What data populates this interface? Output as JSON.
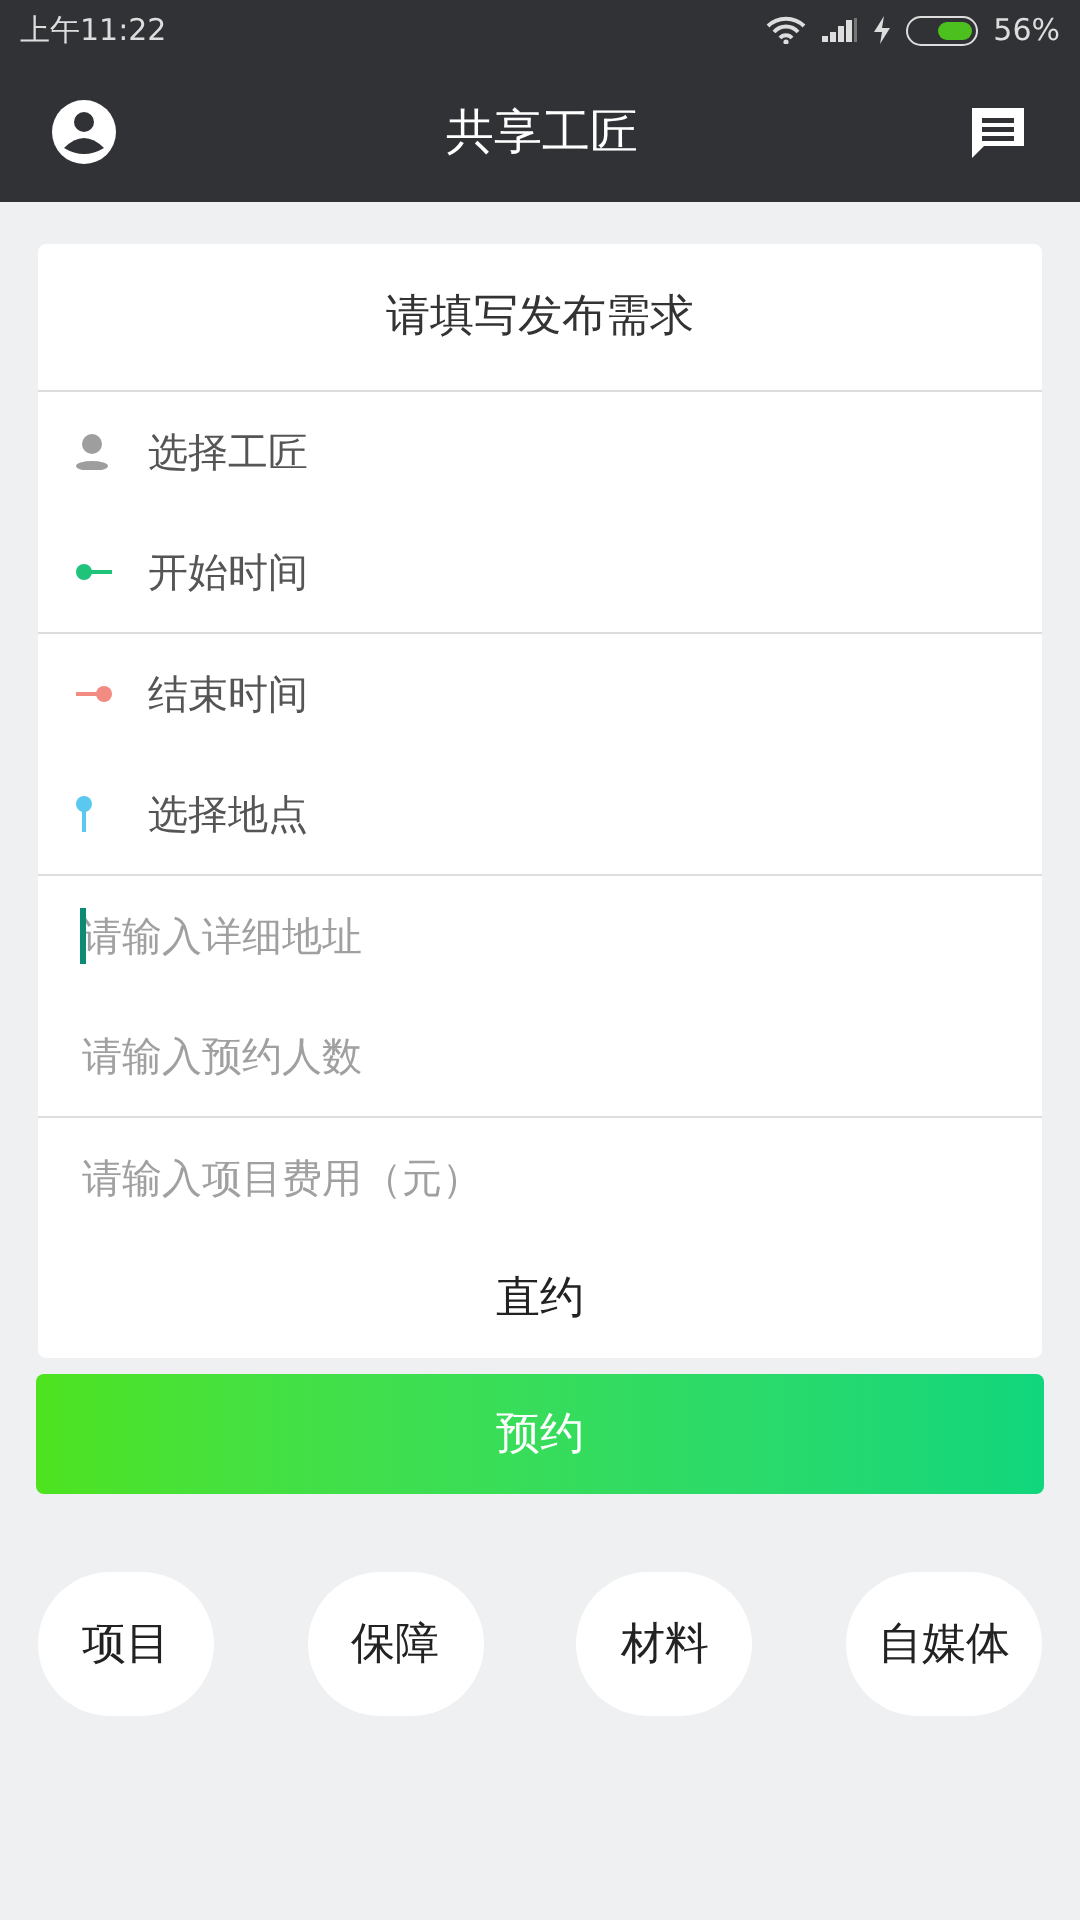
{
  "status_bar": {
    "time": "上午11:22",
    "battery": "56%"
  },
  "app_bar": {
    "title": "共享工匠"
  },
  "form": {
    "title": "请填写发布需求",
    "groups": [
      {
        "kind": "pickers",
        "items": [
          {
            "label": "选择工匠"
          },
          {
            "label": "开始时间"
          }
        ]
      },
      {
        "kind": "pickers",
        "items": [
          {
            "label": "结束时间"
          },
          {
            "label": "选择地点"
          }
        ]
      },
      {
        "kind": "inputs",
        "items": [
          {
            "placeholder": "请输入详细地址",
            "focused": true
          },
          {
            "placeholder": "请输入预约人数",
            "focused": false
          }
        ]
      },
      {
        "kind": "inputs",
        "items": [
          {
            "placeholder": "请输入项目费用（元）",
            "focused": false
          }
        ]
      }
    ],
    "direct_label": "直约"
  },
  "submit": "预约",
  "shortcuts": [
    "项目",
    "保障",
    "材料",
    "自媒体"
  ]
}
